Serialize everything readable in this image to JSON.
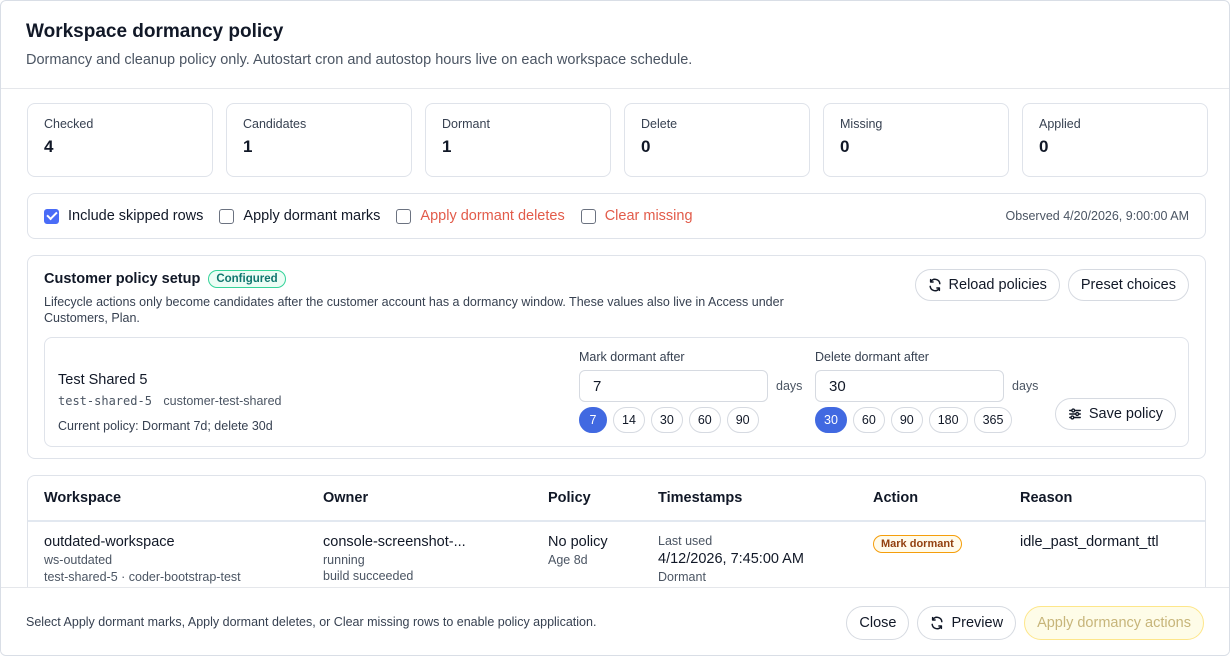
{
  "dialog": {
    "title": "Workspace dormancy policy",
    "subtitle": "Dormancy and cleanup policy only. Autostart cron and autostop hours live on each workspace schedule."
  },
  "stats": [
    {
      "label": "Checked",
      "value": "4"
    },
    {
      "label": "Candidates",
      "value": "1"
    },
    {
      "label": "Dormant",
      "value": "1"
    },
    {
      "label": "Delete",
      "value": "0"
    },
    {
      "label": "Missing",
      "value": "0"
    },
    {
      "label": "Applied",
      "value": "0"
    }
  ],
  "options": {
    "include_skipped": {
      "label": "Include skipped rows",
      "checked": true
    },
    "apply_marks": {
      "label": "Apply dormant marks",
      "checked": false
    },
    "apply_deletes": {
      "label": "Apply dormant deletes",
      "checked": false
    },
    "clear_missing": {
      "label": "Clear missing",
      "checked": false
    },
    "observed": "Observed 4/20/2026, 9:00:00 AM"
  },
  "setup": {
    "title": "Customer policy setup",
    "status_badge": "Configured",
    "description": "Lifecycle actions only become candidates after the customer account has a dormancy window. These values also live in Access under Customers, Plan.",
    "reload_label": "Reload policies",
    "preset_label": "Preset choices",
    "customer": {
      "name": "Test Shared 5",
      "slug": "test-shared-5",
      "id": "customer-test-shared",
      "current_policy": "Current policy: Dormant 7d; delete 30d"
    },
    "mark_dormant": {
      "label": "Mark dormant after",
      "value": "7",
      "unit": "days",
      "presets": [
        "7",
        "14",
        "30",
        "60",
        "90"
      ],
      "selected": "7"
    },
    "delete_dormant": {
      "label": "Delete dormant after",
      "value": "30",
      "unit": "days",
      "presets": [
        "30",
        "60",
        "90",
        "180",
        "365"
      ],
      "selected": "30"
    },
    "save_label": "Save policy"
  },
  "table": {
    "columns": [
      "Workspace",
      "Owner",
      "Policy",
      "Timestamps",
      "Action",
      "Reason"
    ],
    "rows": [
      {
        "workspace": "outdated-workspace",
        "workspace_id": "ws-outdated",
        "workspace_meta": "test-shared-5 · coder-bootstrap-test",
        "owner": "console-screenshot-...",
        "owner_status": "running",
        "owner_build": "build succeeded",
        "policy": "No policy",
        "policy_age": "Age 8d",
        "ts_label": "Last used",
        "ts_value": "4/12/2026, 7:45:00 AM",
        "ts_label2": "Dormant",
        "action": "Mark dormant",
        "reason": "idle_past_dormant_ttl"
      }
    ]
  },
  "footer": {
    "message": "Select Apply dormant marks, Apply dormant deletes, or Clear missing rows to enable policy application.",
    "close_label": "Close",
    "preview_label": "Preview",
    "apply_label": "Apply dormancy actions"
  }
}
